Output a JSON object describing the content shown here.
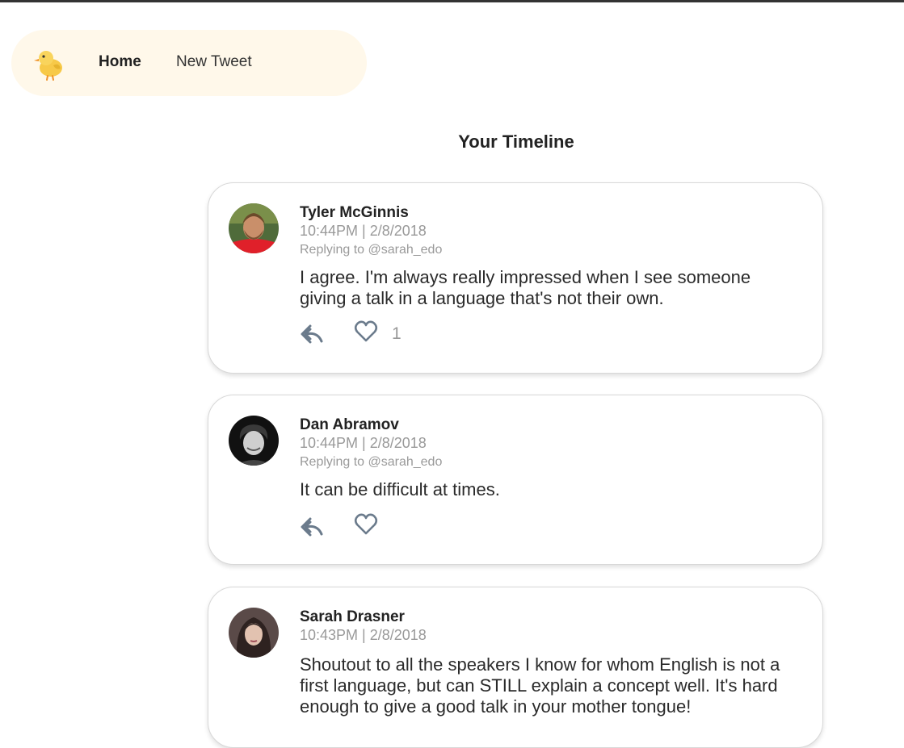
{
  "nav": {
    "logo_icon": "duck-icon",
    "home_label": "Home",
    "new_tweet_label": "New Tweet"
  },
  "page": {
    "title": "Your Timeline"
  },
  "colors": {
    "nav_bg": "#fff8ea",
    "icon": "#6b7b8c",
    "muted_text": "#999999"
  },
  "tweets": [
    {
      "author": "Tyler McGinnis",
      "time": "10:44PM | 2/8/2018",
      "replying": "Replying to @sarah_edo",
      "text": "I agree. I'm always really impressed when I see someone giving a talk in a language that's not their own.",
      "likes": "1",
      "avatar_icon": "avatar-icon"
    },
    {
      "author": "Dan Abramov",
      "time": "10:44PM | 2/8/2018",
      "replying": "Replying to @sarah_edo",
      "text": "It can be difficult at times.",
      "likes": "",
      "avatar_icon": "avatar-icon"
    },
    {
      "author": "Sarah Drasner",
      "time": "10:43PM | 2/8/2018",
      "replying": "",
      "text": "Shoutout to all the speakers I know for whom English is not a first language, but can STILL explain a concept well. It's hard enough to give a good talk in your mother tongue!",
      "likes": "",
      "avatar_icon": "avatar-icon"
    }
  ]
}
